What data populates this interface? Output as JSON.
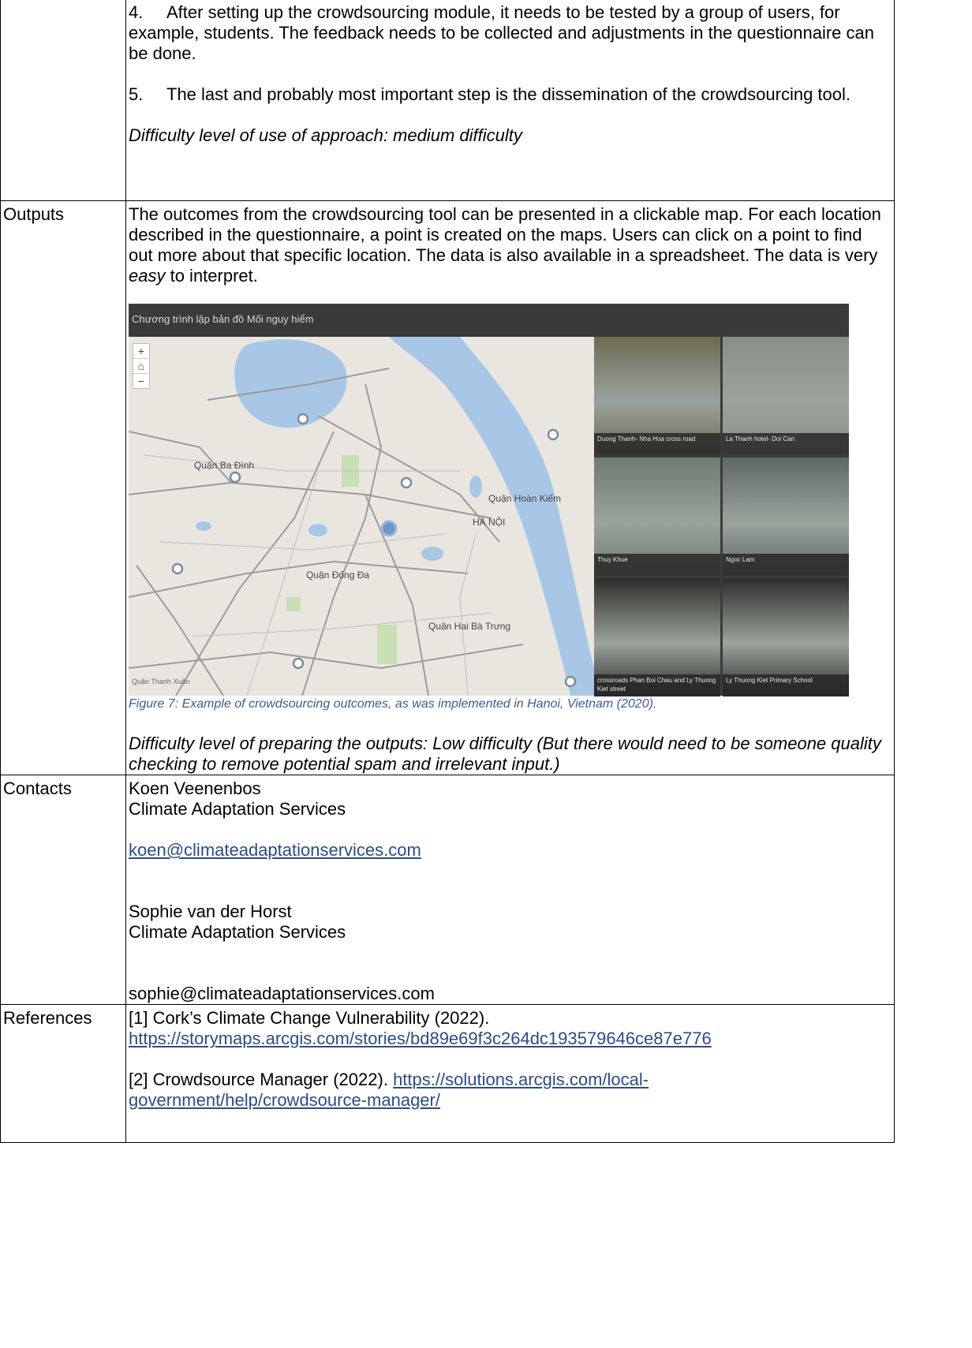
{
  "rows": {
    "steps": {
      "step4_num": "4.",
      "step4_text": "After setting up the crowdsourcing module, it needs to be tested by a group of users, for example, students. The feedback needs to be collected and adjustments in the questionnaire can be done.",
      "step5_num": "5.",
      "step5_text": "The last and probably most important step is the dissemination of the crowdsourcing tool.",
      "difficulty": "Difficulty level of use of approach: medium difficulty"
    },
    "outputs": {
      "label": "Outputs",
      "text_before": "The outcomes from the crowdsourcing tool can be presented in a clickable map. For each location described in the questionnaire, a point is created on the maps. Users can click on a point to find out more about that specific location. The data is also available in a spreadsheet. The data is very ",
      "text_emph": "easy",
      "text_after": " to interpret.",
      "figure_caption": "Figure 7: Example of crowdsourcing outcomes, as was implemented in Hanoi, Vietnam (2020).",
      "difficulty": "Difficulty level of preparing the outputs: Low difficulty (But there would need to be someone quality checking to remove potential spam and irrelevant input.)"
    },
    "map": {
      "title": "Chương trình lập bản đồ Mối nguy hiểm",
      "zoom_in": "+",
      "home": "⌂",
      "zoom_out": "−",
      "labels": {
        "ba_dinh": "Quận Ba Đình",
        "hoan_kiem": "Quận Hoàn Kiếm",
        "ha_noi": "HÀ NỘI",
        "dong_da": "Quận Đống Đa",
        "hai_ba_trung": "Quận Hai Bà Trưng",
        "thanh_xuan": "Quận Thanh Xuân"
      },
      "photos": [
        {
          "caption": "Duong Thanh- Nha Hoa cross road",
          "color": "#6e6a52"
        },
        {
          "caption": "La Thanh hotel- Doi Can",
          "color": "#8a8f88"
        },
        {
          "caption": "Thuy Khue",
          "color": "#6f7a70"
        },
        {
          "caption": "Ngoc Lam",
          "color": "#5e6864"
        },
        {
          "caption": "crossroads Phan Boi Chau and Ly Thuong Kiet street",
          "color": "#2e2b2a"
        },
        {
          "caption": "Ly Thuong Kiet Primary School",
          "color": "#2f2c2b"
        }
      ]
    },
    "contacts": {
      "label": "Contacts",
      "name1": "Koen Veenenbos",
      "org1": "Climate Adaptation Services",
      "email1": "koen@climateadaptationservices.com",
      "name2": "Sophie van der Horst",
      "org2": "Climate Adaptation Services",
      "email2": "sophie@climateadaptationservices.com"
    },
    "references": {
      "label": "References",
      "ref1_text": "[1] Cork’s Climate Change Vulnerability (2022).",
      "ref1_url": "https://storymaps.arcgis.com/stories/bd89e69f3c264dc193579646ce87e776",
      "ref2_text": "[2] Crowdsource Manager (2022). ",
      "ref2_url_1": "https://solutions.arcgis.com/local-",
      "ref2_url_2": "government/help/crowdsource-manager/"
    }
  }
}
